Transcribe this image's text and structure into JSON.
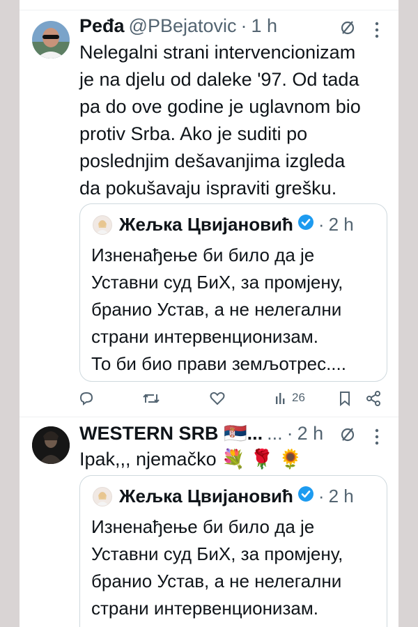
{
  "tweet1": {
    "name": "Peđa",
    "handle": "@PBejatovic",
    "separator": "·",
    "time": "1 h",
    "text": "Nelegalni strani intervencionizam\nje na djelu od daleke '97. Od tada\npa do ove godine je uglavnom bio\nprotiv Srba. Ako je suditi po\nposlednjim dešavanjima izgleda\nda pokušavaju ispraviti grešku.",
    "quote": {
      "name": "Жељка Цвијановић",
      "time": "2 h",
      "text": "Изненађење би било да је\nУставни суд БиХ, за промјену,\nбранио Устав, а не нелегални\nстрани интервенционизам.\nТо би био прави земљотрес...."
    },
    "views": "26",
    "icons": [
      "reply-icon",
      "retweet-icon",
      "like-icon",
      "views-icon",
      "bookmark-icon",
      "share-icon"
    ]
  },
  "tweet2": {
    "name": "WESTERN SRB 🇷🇸...",
    "name_suffix": "...",
    "separator": "·",
    "time": "2 h",
    "text": "Ipak,,, njemačko 💐 🌹 🌻",
    "quote": {
      "name": "Жељка Цвијановић",
      "time": "2 h",
      "text": "Изненађење би било да је\nУставни суд БиХ, за промјену,\nбранио Устав, а не нелегални\nстрани интервенционизам.\nТо би био прави земљотрес...."
    }
  },
  "colors": {
    "text": "#0f1419",
    "muted": "#536471",
    "verified": "#1d9bf0",
    "border": "#cfd9de",
    "backdrop": "#d9d4d4"
  }
}
